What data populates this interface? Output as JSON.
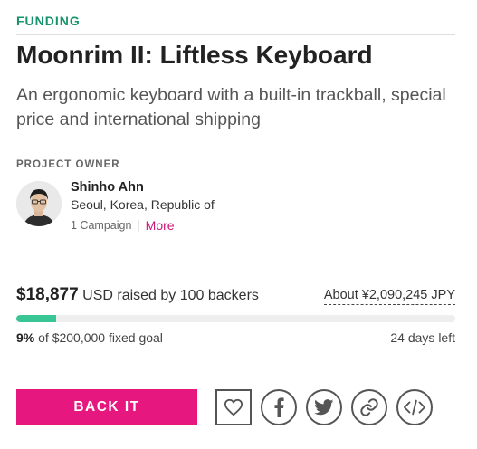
{
  "status": "FUNDING",
  "project": {
    "title": "Moonrim II: Liftless Keyboard",
    "subtitle": "An ergonomic keyboard with a built-in trackball, special price and international shipping"
  },
  "owner": {
    "heading": "PROJECT OWNER",
    "name": "Shinho Ahn",
    "location": "Seoul, Korea, Republic of",
    "campaigns": "1 Campaign",
    "more_label": "More"
  },
  "funding": {
    "amount": "$18,877",
    "raised_text": "USD raised by 100 backers",
    "converted": "About ¥2,090,245 JPY",
    "percent_label": "9%",
    "percent_value": 9,
    "goal_text": "of $200,000",
    "goal_type": "fixed goal",
    "days_left": "24 days left"
  },
  "actions": {
    "back_label": "BACK IT",
    "follow_icon": "heart-icon",
    "share_icons": [
      "facebook-icon",
      "twitter-icon",
      "link-icon",
      "embed-code-icon"
    ]
  },
  "colors": {
    "status": "#17936b",
    "accent": "#e6187f",
    "progress": "#3ac594",
    "link": "#d0177a"
  }
}
